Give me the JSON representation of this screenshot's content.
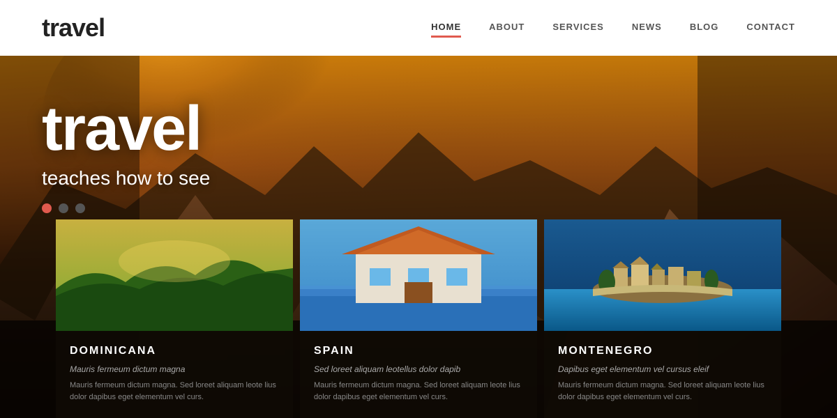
{
  "header": {
    "logo": "travel",
    "nav": [
      {
        "id": "home",
        "label": "HOME",
        "active": true
      },
      {
        "id": "about",
        "label": "ABOUT",
        "active": false
      },
      {
        "id": "services",
        "label": "SERVICES",
        "active": false
      },
      {
        "id": "news",
        "label": "NEWS",
        "active": false
      },
      {
        "id": "blog",
        "label": "BLOG",
        "active": false
      },
      {
        "id": "contact",
        "label": "CONTACT",
        "active": false
      }
    ]
  },
  "hero": {
    "title": "travel",
    "subtitle": "teaches how to see",
    "dots": [
      {
        "id": "dot1",
        "active": true
      },
      {
        "id": "dot2",
        "active": false
      },
      {
        "id": "dot3",
        "active": false
      }
    ]
  },
  "cards": [
    {
      "id": "dominicana",
      "title": "DOMINICANA",
      "subtitle": "Mauris fermeum dictum magna",
      "text": "Mauris fermeum dictum magna. Sed loreet aliquam leote lius dolor dapibus eget elementum vel curs."
    },
    {
      "id": "spain",
      "title": "SPAIN",
      "subtitle": "Sed loreet aliquam leotellus dolor dapib",
      "text": "Mauris fermeum dictum magna. Sed loreet aliquam leote lius dolor dapibus eget elementum vel curs."
    },
    {
      "id": "montenegro",
      "title": "MONTENEGRO",
      "subtitle": "Dapibus eget elementum vel cursus eleif",
      "text": "Mauris fermeum dictum magna. Sed loreet aliquam leote lius dolor dapibus eget elementum vel curs."
    }
  ],
  "colors": {
    "accent": "#e05a4e",
    "nav_active_underline": "#e05a4e"
  }
}
